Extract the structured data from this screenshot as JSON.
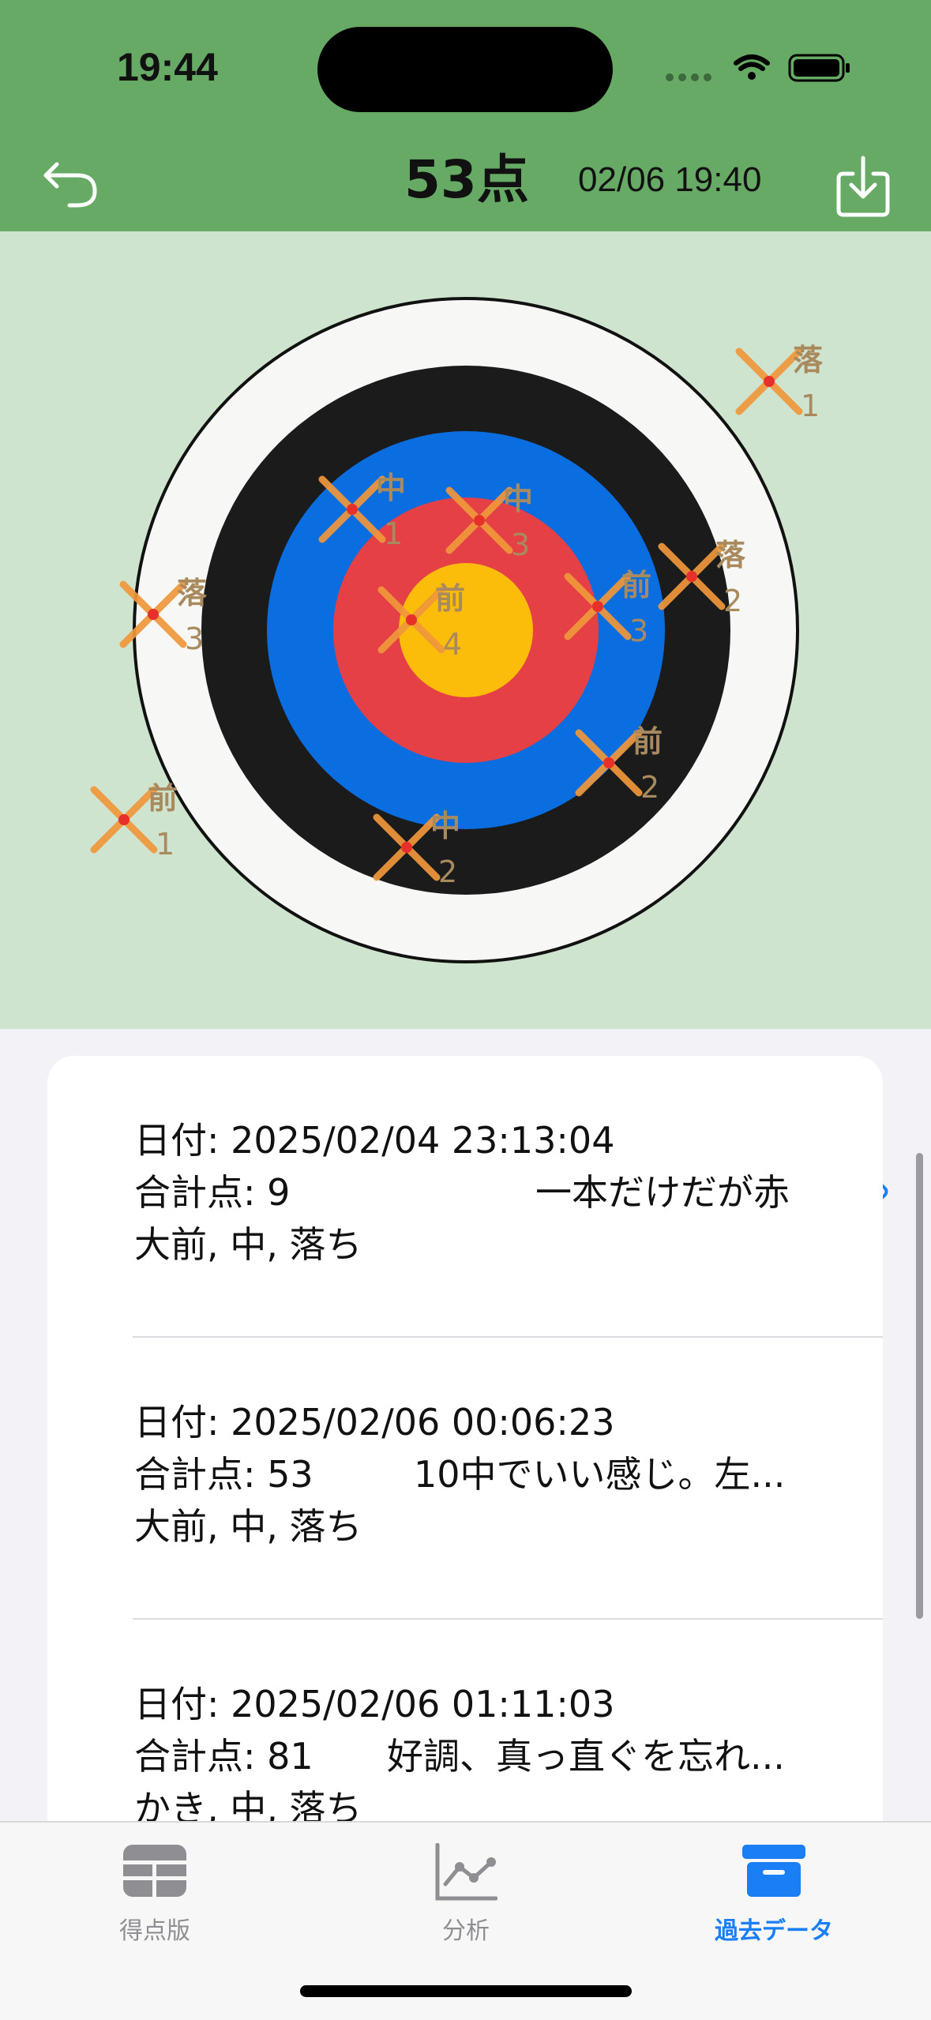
{
  "status_bar": {
    "time": "19:44"
  },
  "header": {
    "title": "53点",
    "datetime": "02/06 19:40",
    "colors": {
      "background": "#66aa66"
    }
  },
  "target": {
    "colors": {
      "background": "#cfe4cf",
      "ring_white": "#f7f8f5",
      "ring_black": "#1b1b1b",
      "ring_blue": "#0a6ee0",
      "ring_red": "#e54045",
      "ring_gold": "#fcbd0a",
      "marker": "#f0973b",
      "marker_center": "#e8302a",
      "label": "#a98a5f"
    },
    "shots": [
      {
        "label": "落",
        "number": "1"
      },
      {
        "label": "中",
        "number": "1"
      },
      {
        "label": "中",
        "number": "3"
      },
      {
        "label": "落",
        "number": "2"
      },
      {
        "label": "落",
        "number": "3"
      },
      {
        "label": "前",
        "number": "4"
      },
      {
        "label": "前",
        "number": "3"
      },
      {
        "label": "前",
        "number": "2"
      },
      {
        "label": "前",
        "number": "1"
      },
      {
        "label": "中",
        "number": "2"
      }
    ]
  },
  "records": [
    {
      "date_line": "日付: 2025/02/04 23:13:04",
      "score_line": "合計点: 9",
      "comment": "一本だけだが赤",
      "shots_line": "大前, 中, 落ち"
    },
    {
      "date_line": "日付: 2025/02/06 00:06:23",
      "score_line": "合計点: 53",
      "comment": "10中でいい感じ。左...",
      "shots_line": "大前, 中, 落ち"
    },
    {
      "date_line": "日付: 2025/02/06 01:11:03",
      "score_line": "合計点: 81",
      "comment": "好調、真っ直ぐを忘れ...",
      "shots_line": "かき, 中, 落ち"
    }
  ],
  "tabs": [
    {
      "label": "得点版",
      "icon": "table-icon",
      "selected": false
    },
    {
      "label": "分析",
      "icon": "chart-icon",
      "selected": false
    },
    {
      "label": "過去データ",
      "icon": "archive-box-icon",
      "selected": true
    }
  ],
  "accent_color": "#1a7ef5"
}
